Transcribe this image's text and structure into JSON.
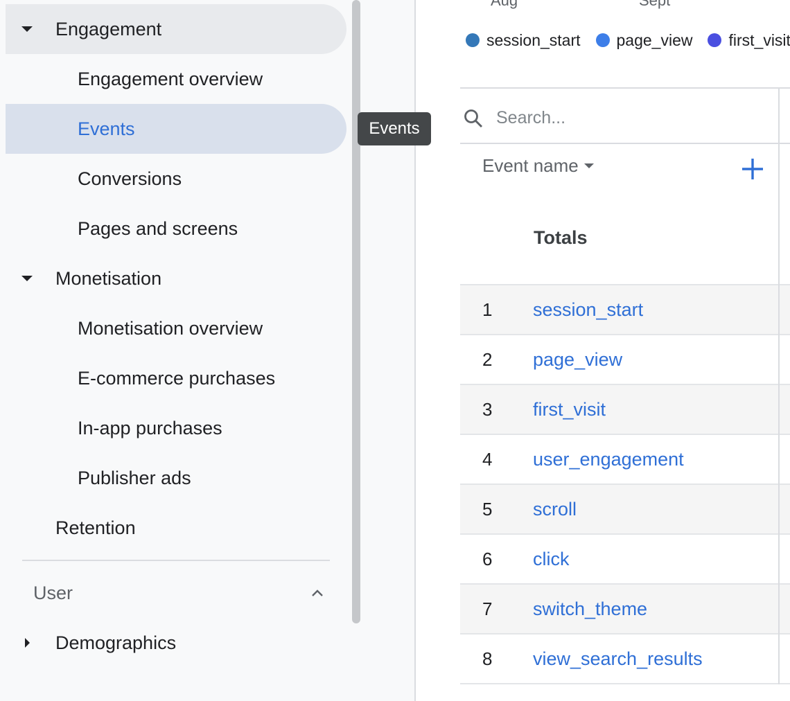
{
  "sidebar": {
    "engagement": {
      "label": "Engagement",
      "items": [
        {
          "label": "Engagement overview"
        },
        {
          "label": "Events"
        },
        {
          "label": "Conversions"
        },
        {
          "label": "Pages and screens"
        }
      ]
    },
    "monetisation": {
      "label": "Monetisation",
      "items": [
        {
          "label": "Monetisation overview"
        },
        {
          "label": "E-commerce purchases"
        },
        {
          "label": "In-app purchases"
        },
        {
          "label": "Publisher ads"
        }
      ]
    },
    "retention": {
      "label": "Retention"
    },
    "user_section": {
      "label": "User"
    },
    "demographics": {
      "label": "Demographics"
    }
  },
  "tooltip": {
    "text": "Events"
  },
  "chart": {
    "x_ticks": [
      "Aug",
      "Sept"
    ],
    "legend": [
      {
        "name": "session_start",
        "color": "#3478b8"
      },
      {
        "name": "page_view",
        "color": "#3d7ee8"
      },
      {
        "name": "first_visit",
        "color": "#4a4fe0"
      }
    ]
  },
  "table": {
    "search": {
      "placeholder": "Search..."
    },
    "column_header": "Event name",
    "totals_label": "Totals",
    "rows": [
      {
        "num": "1",
        "event": "session_start"
      },
      {
        "num": "2",
        "event": "page_view"
      },
      {
        "num": "3",
        "event": "first_visit"
      },
      {
        "num": "4",
        "event": "user_engagement"
      },
      {
        "num": "5",
        "event": "scroll"
      },
      {
        "num": "6",
        "event": "click"
      },
      {
        "num": "7",
        "event": "switch_theme"
      },
      {
        "num": "8",
        "event": "view_search_results"
      }
    ]
  },
  "colors": {
    "accent": "#2f6fd6",
    "selected_bg": "#d9e0ec"
  }
}
